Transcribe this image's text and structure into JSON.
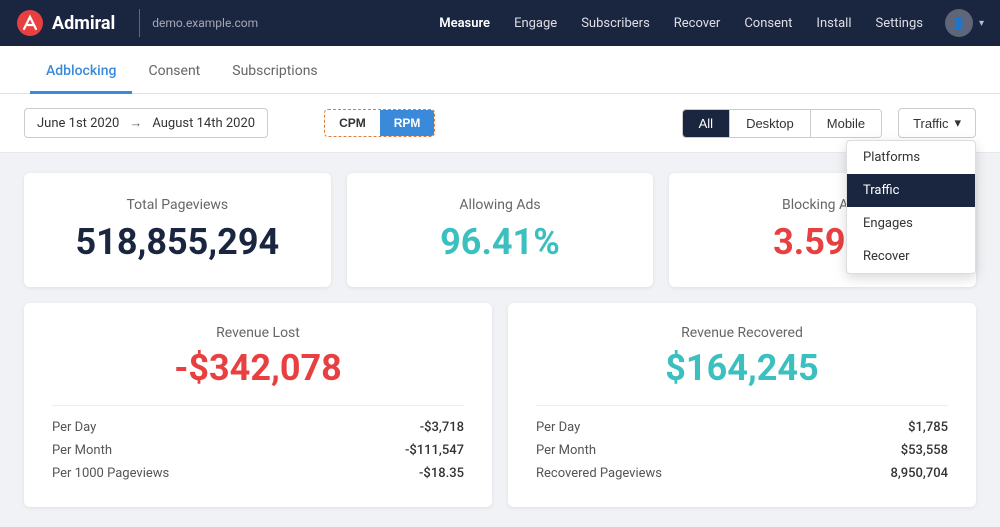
{
  "navbar": {
    "logo_text": "Admiral",
    "site_name": "demo.example.com",
    "links": [
      {
        "label": "Measure",
        "active": true
      },
      {
        "label": "Engage",
        "active": false
      },
      {
        "label": "Subscribers",
        "active": false
      },
      {
        "label": "Recover",
        "active": false
      },
      {
        "label": "Consent",
        "active": false
      },
      {
        "label": "Install",
        "active": false
      },
      {
        "label": "Settings",
        "active": false
      }
    ]
  },
  "tabs": [
    {
      "label": "Adblocking",
      "active": true
    },
    {
      "label": "Consent",
      "active": false
    },
    {
      "label": "Subscriptions",
      "active": false
    }
  ],
  "controls": {
    "date_from": "June 1st 2020",
    "date_to": "August 14th 2020",
    "cpm_label": "CPM",
    "rpm_label": "RPM",
    "active_toggle": "RPM",
    "devices": [
      "All",
      "Desktop",
      "Mobile"
    ],
    "active_device": "All",
    "traffic_label": "Traffic",
    "dropdown_items": [
      {
        "label": "Platforms",
        "selected": false
      },
      {
        "label": "Traffic",
        "selected": true
      },
      {
        "label": "Engages",
        "selected": false
      },
      {
        "label": "Recover",
        "selected": false
      }
    ]
  },
  "stats": [
    {
      "label": "Total Pageviews",
      "value": "518,855,294",
      "color": "dark"
    },
    {
      "label": "Allowing Ads",
      "value": "96.41%",
      "color": "teal"
    },
    {
      "label": "Blocking Ads",
      "value": "3.59%",
      "color": "red"
    }
  ],
  "revenue": [
    {
      "title": "Revenue Lost",
      "value": "-$342,078",
      "color": "red",
      "rows": [
        {
          "label": "Per Day",
          "value": "-$3,718"
        },
        {
          "label": "Per Month",
          "value": "-$111,547"
        },
        {
          "label": "Per 1000 Pageviews",
          "value": "-$18.35"
        }
      ]
    },
    {
      "title": "Revenue Recovered",
      "value": "$164,245",
      "color": "teal",
      "rows": [
        {
          "label": "Per Day",
          "value": "$1,785"
        },
        {
          "label": "Per Month",
          "value": "$53,558"
        },
        {
          "label": "Recovered Pageviews",
          "value": "8,950,704"
        }
      ]
    }
  ]
}
